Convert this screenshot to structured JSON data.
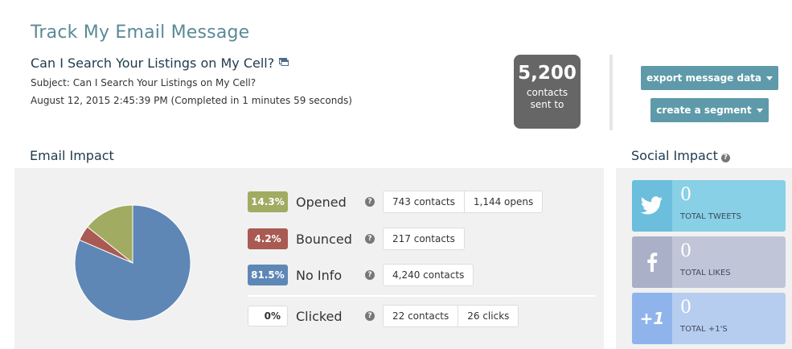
{
  "page": {
    "title": "Track My Email Message"
  },
  "message": {
    "title": "Can I Search Your Listings on My Cell?",
    "subject": "Subject: Can I Search Your Listings on My Cell?",
    "date": "August 12, 2015 2:45:39 PM (Completed in 1 minutes 59 seconds)"
  },
  "sent": {
    "count": "5,200",
    "label_line1": "contacts",
    "label_line2": "sent to"
  },
  "actions": {
    "export_label": "export message data",
    "segment_label": "create a segment"
  },
  "email_impact": {
    "title": "Email Impact",
    "metrics": [
      {
        "pct": "14.3%",
        "label": "Opened",
        "color": "#a2ab62",
        "pills": [
          "743 contacts",
          "1,144 opens"
        ]
      },
      {
        "pct": "4.2%",
        "label": "Bounced",
        "color": "#a95a52",
        "pills": [
          "217 contacts"
        ]
      },
      {
        "pct": "81.5%",
        "label": "No Info",
        "color": "#5e87b6",
        "pills": [
          "4,240 contacts"
        ]
      },
      {
        "pct": "0%",
        "label": "Clicked",
        "color": "#ffffff",
        "pills": [
          "22 contacts",
          "26 clicks"
        ]
      }
    ],
    "pie": [
      {
        "name": "Opened",
        "value": 14.3,
        "color": "#a2ab62"
      },
      {
        "name": "Bounced",
        "value": 4.2,
        "color": "#a95a52"
      },
      {
        "name": "No Info",
        "value": 81.5,
        "color": "#5e87b6"
      }
    ]
  },
  "social_impact": {
    "title": "Social Impact",
    "cards": [
      {
        "count": "0",
        "label": "TOTAL TWEETS",
        "icon": "twitter-bird-icon",
        "color": "#88d0e6",
        "icon_color": "#6bbedc"
      },
      {
        "count": "0",
        "label": "TOTAL LIKES",
        "icon": "facebook-f-icon",
        "color": "#c0c5d8",
        "icon_color": "#a9b0c8"
      },
      {
        "count": "0",
        "label": "TOTAL +1'S",
        "icon": "google-plus-one-icon",
        "icon_text": "+1",
        "color": "#b7cdf0",
        "icon_color": "#8fb4ec"
      }
    ]
  }
}
